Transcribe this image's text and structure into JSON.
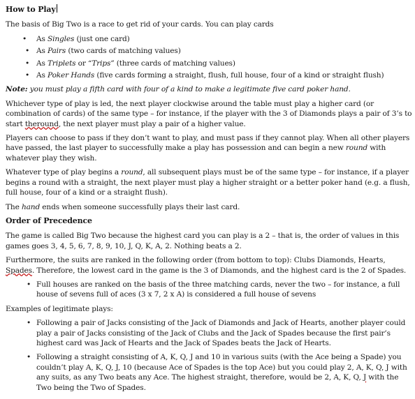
{
  "heading_how_to_play": "How to Play",
  "intro": "The basis of Big Two is a race to get rid of your cards. You can play cards",
  "play_types": [
    {
      "prefix": "As ",
      "name": "Singles",
      "rest": " (just one card)"
    },
    {
      "prefix": "As ",
      "name": "Pairs",
      "rest": " (two cards of matching values)"
    },
    {
      "prefix": "As ",
      "name": "Triplets",
      "mid": " or ",
      "alt": "“Trips”",
      "rest": " (three cards of matching values)"
    },
    {
      "prefix": "As ",
      "name": "Poker Hands",
      "rest": " (five cards forming a straight, flush, full house, four of a kind or straight flush)"
    }
  ],
  "note": {
    "label": "Note:",
    "text": " you must play a fifth card with four of a kind to make a legitimate five card poker hand."
  },
  "para_whichever": {
    "before": "Whichever type of play is led, the next player clockwise around the table must play a higher card (or combination of cards) of the same type – for instance, if the player with the 3 of Diamonds plays a pair of 3’s to start ",
    "underlined": "theround",
    "after": ", the next player must play a pair of a higher value."
  },
  "para_pass": {
    "before": "Players can choose to pass if they don’t want to play, and must pass if they cannot play. When all other players have passed, the last player to successfully make a play has possession and can begin a new ",
    "italic": "round",
    "after": " with whatever play they wish."
  },
  "para_round": {
    "before": "Whatever type of play begins a ",
    "italic": "round",
    "after": ", all subsequent plays must be of the same type – for instance, if a player begins a round with a straight, the next player must play a higher straight or a better poker hand (e.g. a flush, full house, four of a kind or a straight flush)."
  },
  "para_hand": {
    "before": "The ",
    "italic": "hand",
    "after": " ends when someone successfully plays their last card."
  },
  "heading_precedence": "Order of Precedence",
  "para_order": "The game is called Big Two because the highest card you can play is a 2 – that is, the order of values in this games goes 3, 4, 5, 6, 7, 8, 9, 10, J, Q, K, A, 2. Nothing beats a 2.",
  "para_suits": {
    "before": "Furthermore, the suits are ranked in the following order (from bottom to top): Clubs Diamonds, Hearts, ",
    "underlined": "Spades",
    "after": ". Therefore, the lowest card in the game is the 3 of Diamonds, and the highest card is the 2 of Spades."
  },
  "full_house_bullet": "Full houses are ranked on the basis of the three matching cards, never the two – for instance, a full house of sevens full of aces (3 x 7, 2 x A) is considered a full house of sevens",
  "examples_intro": "Examples of legitimate plays:",
  "example_bullets": [
    {
      "text": "Following a pair of Jacks consisting of the Jack of Diamonds and Jack of Hearts, another player could play a pair of Jacks consisting of the Jack of Clubs and the Jack of Spades because the first pair’s highest card was Jack of Hearts and the Jack of Spades beats the Jack of Hearts."
    },
    {
      "before": "Following a straight consisting of A, K, Q, J and 10 in various suits (with the Ace being a Spade) you couldn’t play A, K, Q, J, 10 (because Ace of Spades is the top Ace) but you could play 2, A, K, Q, J with any suits, as any Two beats any Ace. The highest straight, therefore, would be 2, A, K, Q, ",
      "underlined": "J",
      "after": " with the Two being the Two of Spades."
    }
  ]
}
